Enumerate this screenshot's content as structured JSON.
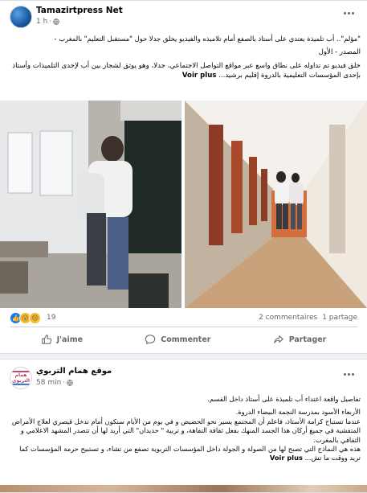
{
  "post1": {
    "page_name": "Tamazirtpress Net",
    "time": "1 h",
    "icons": {
      "privacy": "globe-icon",
      "more": "more-options-icon"
    },
    "text_lines": [
      "\"مؤلم\".. أب تلميذة يعتدي على أستاذ بالصفع أمام تلاميذه والفيديو يخلق جدلا حول \"مستقبل التعليم\" بالمغرب -",
      "المصدر - الأول",
      "خلق فيديو تم تداوله على نطاق واسع عبر مواقع التواصل الاجتماعي، جدلا، وهو يوثق لشجار بين أب لإحدى التلميذات وأستاذ بإحدى المؤسسات التعليمية بالدروة إقليم برشيد..."
    ],
    "voir_plus": "Voir plus",
    "reactions": {
      "count": "19",
      "types": [
        "like-icon",
        "wow-icon",
        "sad-icon"
      ]
    },
    "comments": "2 commentaires",
    "shares": "1 partage",
    "actions": {
      "like": "J'aime",
      "comment": "Commenter",
      "share": "Partager"
    },
    "colors": {
      "accent": "#1877f2",
      "muted": "#65676b"
    }
  },
  "post2": {
    "page_name": "موقع همام التربوي",
    "time": "58 min",
    "avatar_text": "همام التربوي",
    "icons": {
      "privacy": "globe-icon",
      "more": "more-options-icon"
    },
    "text_lines": [
      "تفاصيل واقعة اعتداء أب تلميذة على أستاذ داخل القسم.",
      "الأربعاء الأسود بمدرسة النجمة البيضاء الدروة.",
      "عندما تستباح كرامة الأستاذ، فاعلم أن المجتمع يسير نحو الحضيض و في يوم من الأيام سنكون أمام تدخل قيصري لعلاج الأمراض المتفشية في جميع أركان هذا الجسد المنهك بفعل ثقافة التفاهة، و تربية \" حديدان\" التي أريد لها أن تتصدر المشهد الاعلامي و الثقافي بالمغرب.",
      "هذه هي النماذج التي تصبح لها من الصولة و الجولة داخل المؤسسات التربوية تصفع من تشاء، و تستبيح حرمة المؤسسات كما تريد ووقت ما تش..."
    ],
    "voir_plus": "Voir plus"
  }
}
